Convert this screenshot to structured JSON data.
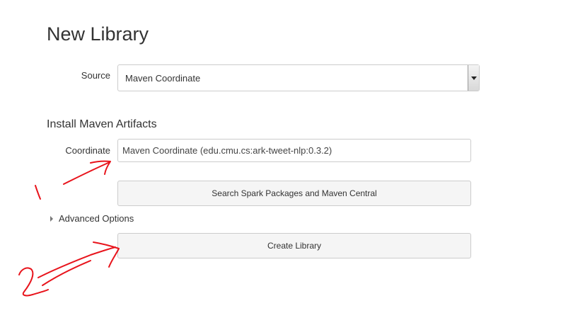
{
  "page": {
    "title": "New Library"
  },
  "source": {
    "label": "Source",
    "selected": "Maven Coordinate"
  },
  "install": {
    "section_title": "Install Maven Artifacts",
    "coordinate_label": "Coordinate",
    "coordinate_placeholder": "Maven Coordinate (edu.cmu.cs:ark-tweet-nlp:0.3.2)",
    "coordinate_value": ""
  },
  "buttons": {
    "search": "Search Spark Packages and Maven Central",
    "create": "Create Library"
  },
  "advanced": {
    "label": "Advanced Options"
  },
  "colors": {
    "annotation": "#e8141c",
    "button_bg": "#f5f5f5",
    "border": "#cccccc"
  }
}
